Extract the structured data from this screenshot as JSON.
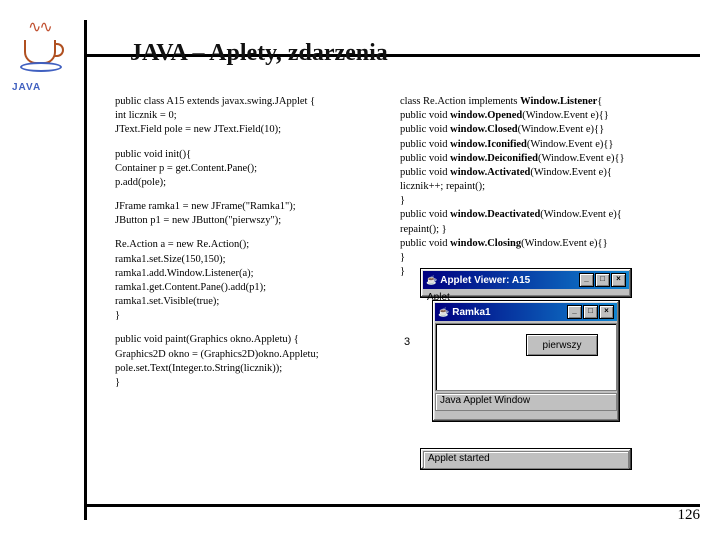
{
  "title": "JAVA – Aplety, zdarzenia",
  "page_number": "126",
  "code_left": {
    "b1": [
      "public class A15 extends javax.swing.JApplet {",
      " int licznik = 0;",
      " JText.Field pole =  new JText.Field(10);"
    ],
    "b2": [
      " public void init(){",
      "  Container p = get.Content.Pane();",
      "  p.add(pole);"
    ],
    "b3": [
      "  JFrame  ramka1 = new JFrame(\"Ramka1\");",
      "  JButton p1 = new JButton(\"pierwszy\");"
    ],
    "b4": [
      "  Re.Action a = new Re.Action();",
      "  ramka1.set.Size(150,150);",
      "  ramka1.add.Window.Listener(a);",
      "  ramka1.get.Content.Pane().add(p1);",
      "  ramka1.set.Visible(true);",
      " }"
    ],
    "b5": [
      "public void paint(Graphics okno.Appletu) {",
      "  Graphics2D okno = (Graphics2D)okno.Appletu;",
      "  pole.set.Text(Integer.to.String(licznik));",
      " }"
    ]
  },
  "code_right": {
    "lines": [
      {
        "pre": "class Re.Action implements ",
        "b": "Window.Listener",
        "post": "{"
      },
      {
        "pre": " public void ",
        "b": "window.Opened",
        "post": "(Window.Event e){}"
      },
      {
        "pre": " public void ",
        "b": "window.Closed",
        "post": "(Window.Event e){}"
      },
      {
        "pre": " public void ",
        "b": "window.Iconified",
        "post": "(Window.Event e){}"
      },
      {
        "pre": " public void ",
        "b": "window.Deiconified",
        "post": "(Window.Event e){}"
      },
      {
        "pre": " public void ",
        "b": "window.Activated",
        "post": "(Window.Event e){"
      },
      {
        "pre": " licznik++; repaint();",
        "b": "",
        "post": ""
      },
      {
        "pre": " }",
        "b": "",
        "post": ""
      },
      {
        "pre": " public void ",
        "b": "window.Deactivated",
        "post": "(Window.Event e){"
      },
      {
        "pre": " repaint(); }",
        "b": "",
        "post": ""
      },
      {
        "pre": " public void ",
        "b": "window.Closing",
        "post": "(Window.Event e){}"
      },
      {
        "pre": " }",
        "b": "",
        "post": ""
      },
      {
        "pre": " }",
        "b": "",
        "post": ""
      }
    ]
  },
  "mock": {
    "applet_viewer_title": "Applet Viewer: A15",
    "applet_menu": "Aplet",
    "ramka_title": "Ramka1",
    "button_label": "pierwszy",
    "java_window_title": "Java Applet Window",
    "status_text": "Applet started",
    "counter_value": "3"
  }
}
